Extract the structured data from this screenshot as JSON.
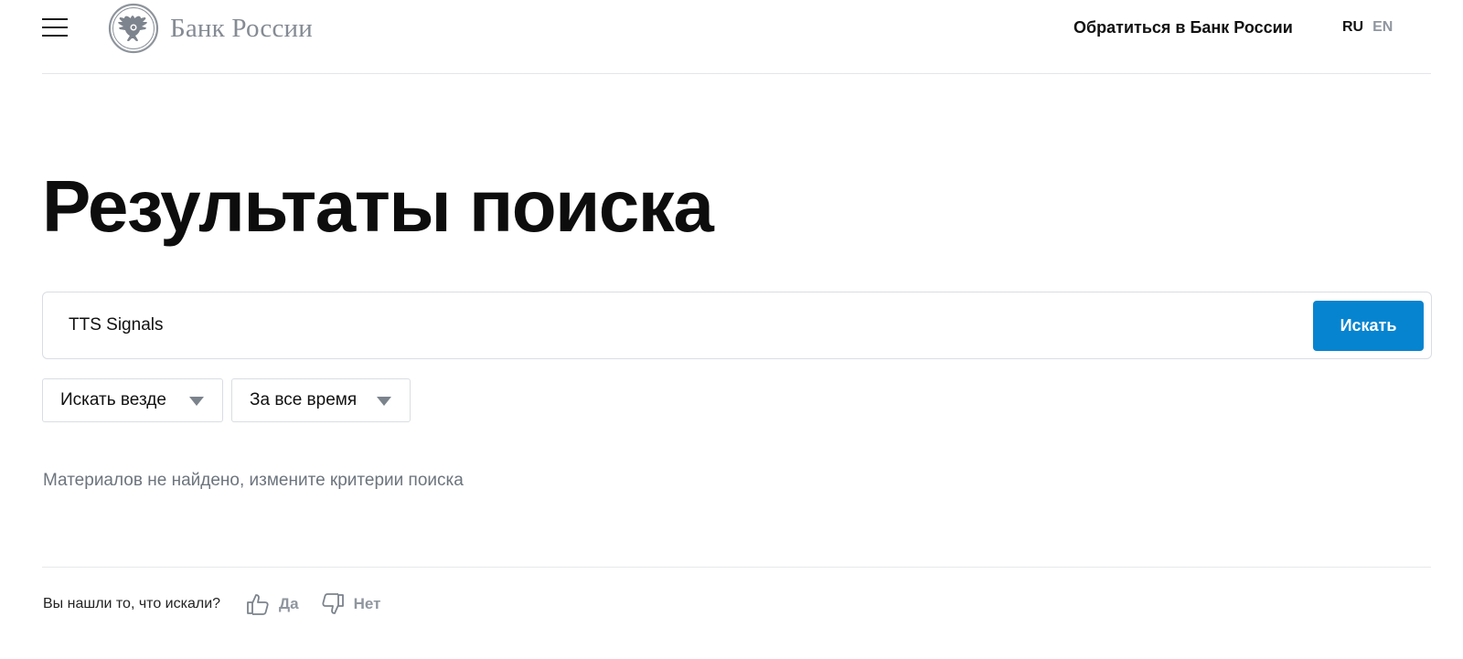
{
  "header": {
    "logo_text": "Банк России",
    "contact_link": "Обратиться в Банк России",
    "languages": {
      "ru": "RU",
      "en": "EN"
    }
  },
  "page_title": "Результаты поиска",
  "search": {
    "value": "TTS Signals",
    "button_label": "Искать"
  },
  "filters": {
    "scope": "Искать везде",
    "period": "За все время"
  },
  "no_results_text": "Материалов не найдено, измените критерии поиска",
  "feedback": {
    "question": "Вы нашли то, что искали?",
    "yes_label": "Да",
    "no_label": "Нет"
  },
  "colors": {
    "accent": "#0784d0",
    "muted_text": "#6c747d",
    "logo_gray": "#858b94"
  }
}
